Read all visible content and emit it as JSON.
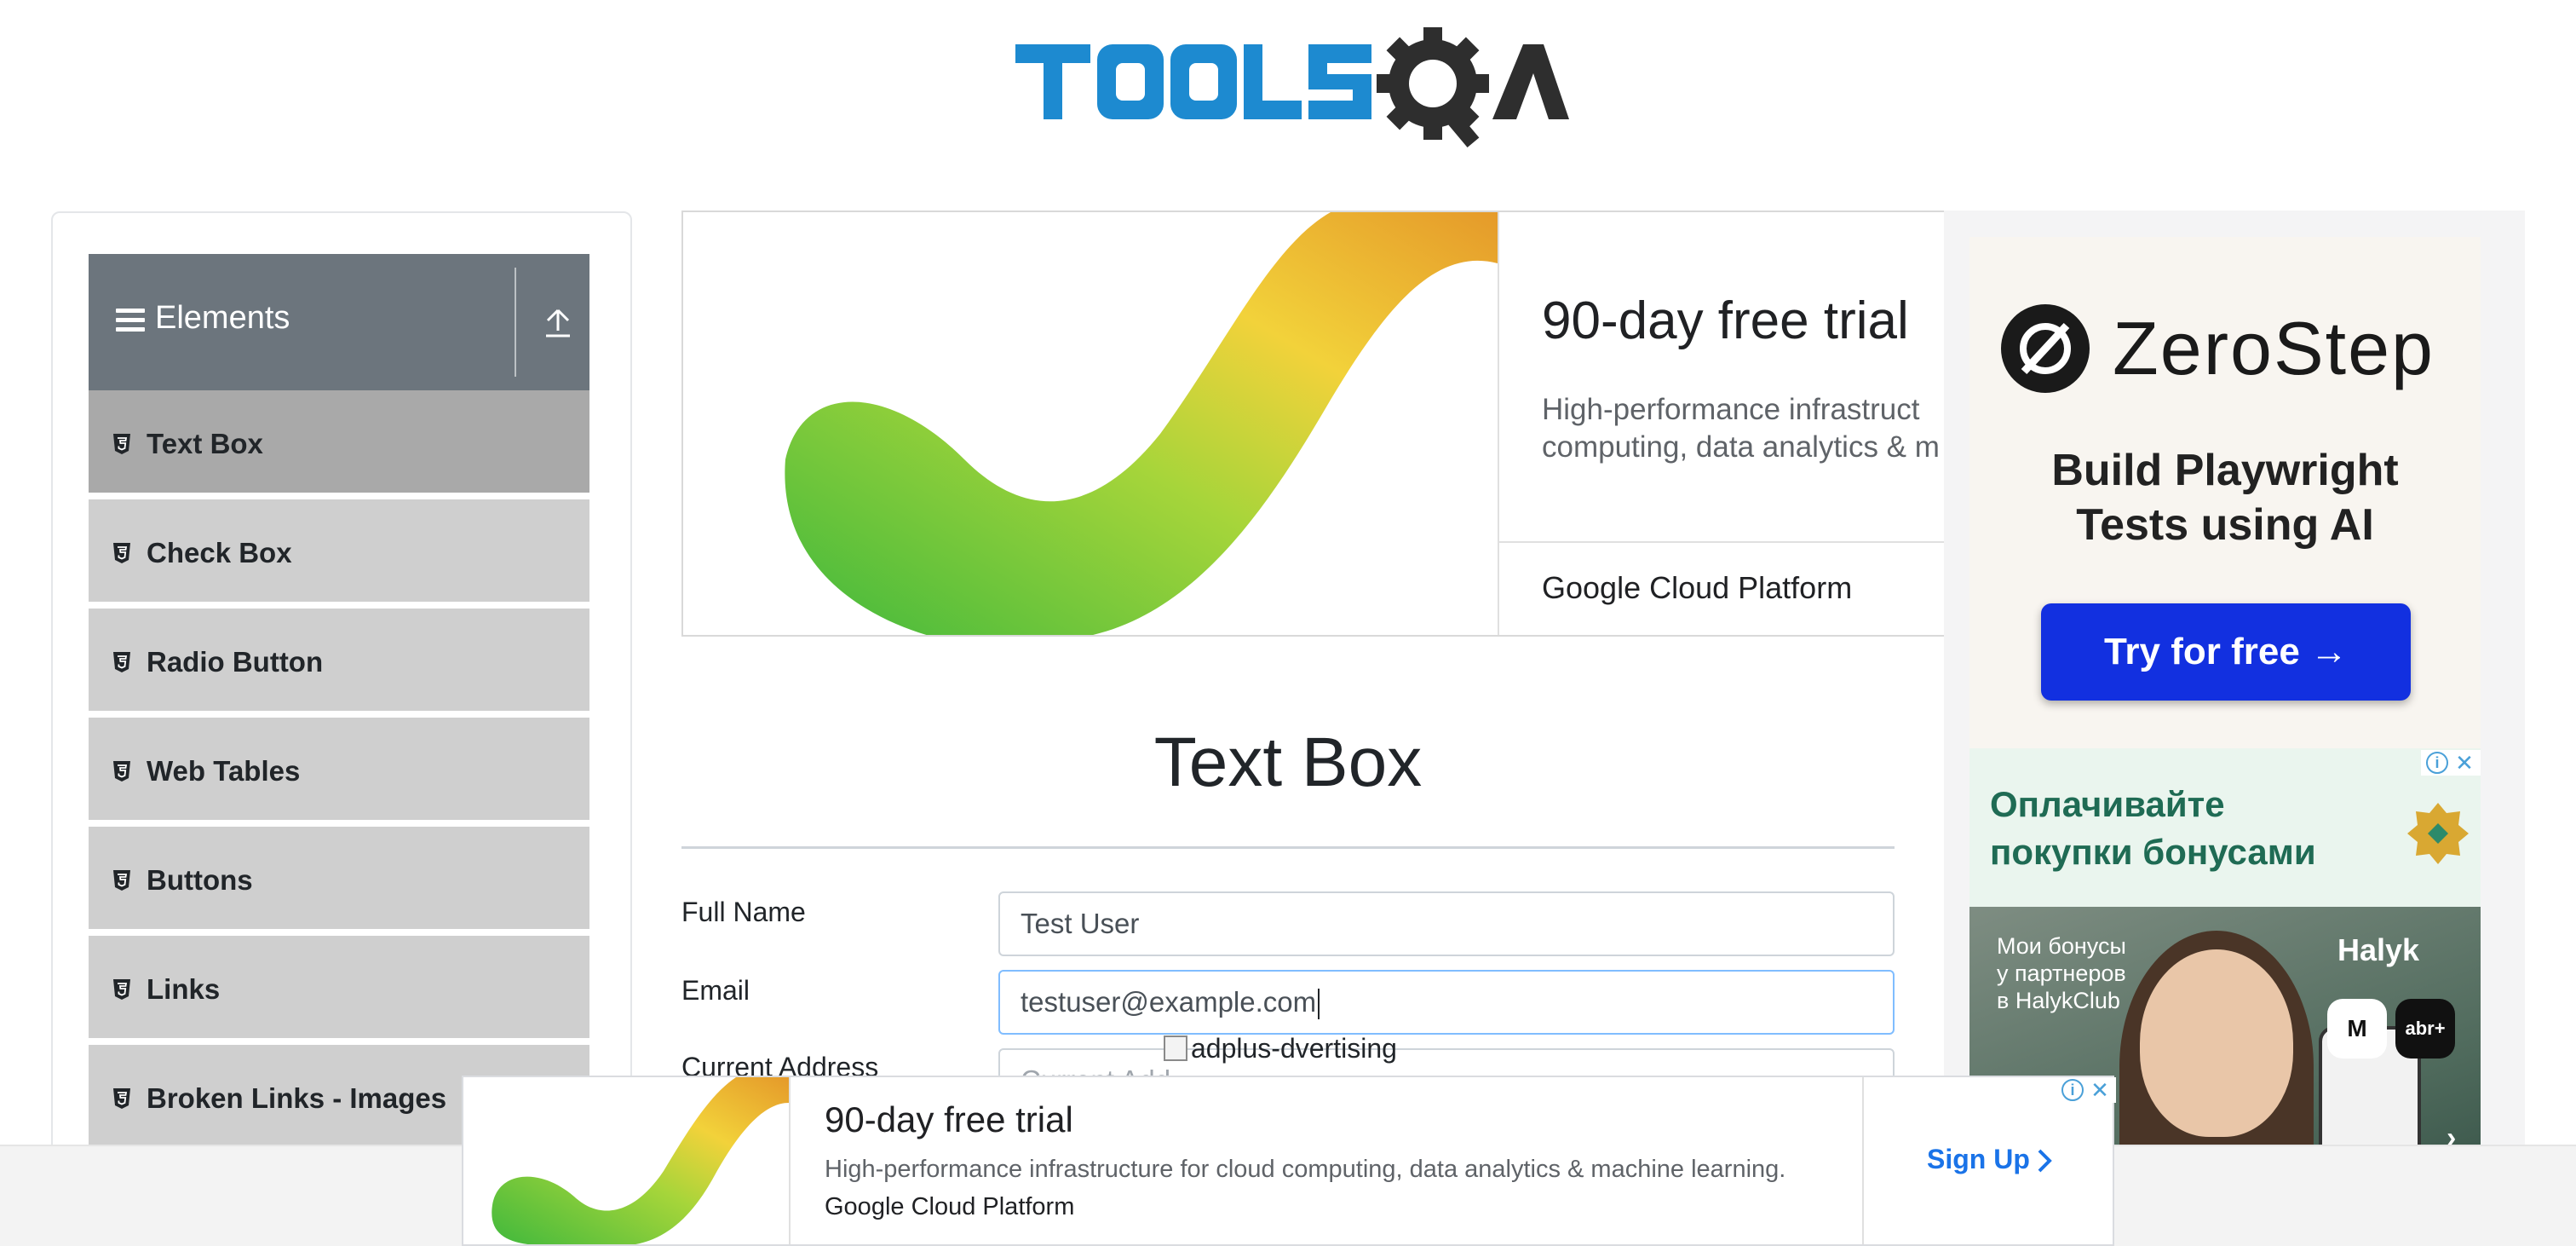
{
  "logo": {
    "text_part1": "TOOLS",
    "text_part2": "A",
    "primary_color": "#1d8ad0",
    "gear_color": "#2e2e2e"
  },
  "sidebar": {
    "group_title": "Elements",
    "items": [
      {
        "label": "Text Box",
        "active": true
      },
      {
        "label": "Check Box",
        "active": false
      },
      {
        "label": "Radio Button",
        "active": false
      },
      {
        "label": "Web Tables",
        "active": false
      },
      {
        "label": "Buttons",
        "active": false
      },
      {
        "label": "Links",
        "active": false
      },
      {
        "label": "Broken Links - Images",
        "active": false
      }
    ]
  },
  "top_ad": {
    "title": "90-day free trial",
    "body_line1": "High-performance infrastruct",
    "body_line2": "computing, data analytics & m",
    "brand": "Google Cloud Platform"
  },
  "form": {
    "page_title": "Text Box",
    "full_name_label": "Full Name",
    "full_name_value": "Test User",
    "email_label": "Email",
    "email_value": "testuser@example.com",
    "current_address_label": "Current Address",
    "current_address_placeholder": "Current Add"
  },
  "broken_image": {
    "alt": "adplus-dvertising"
  },
  "right_ad": {
    "brand": "ZeroStep",
    "headline_line1": "Build Playwright",
    "headline_line2": "Tests using AI",
    "cta": "Try for free →",
    "cta_color": "#1230e0"
  },
  "halyk_ad": {
    "headline_line1": "Оплачивайте",
    "headline_line2": "покупки бонусами",
    "photo_line1": "Мои бонусы",
    "photo_line2": "у партнеров",
    "photo_line3": "в HalykClub",
    "brand": "Halyk",
    "badge1": "M",
    "badge2": "abr+",
    "arrow": "›"
  },
  "sticky_ad": {
    "title": "90-day free trial",
    "body": "High-performance infrastructure for cloud computing, data analytics & machine learning.",
    "brand": "Google Cloud Platform",
    "cta": "Sign Up"
  }
}
